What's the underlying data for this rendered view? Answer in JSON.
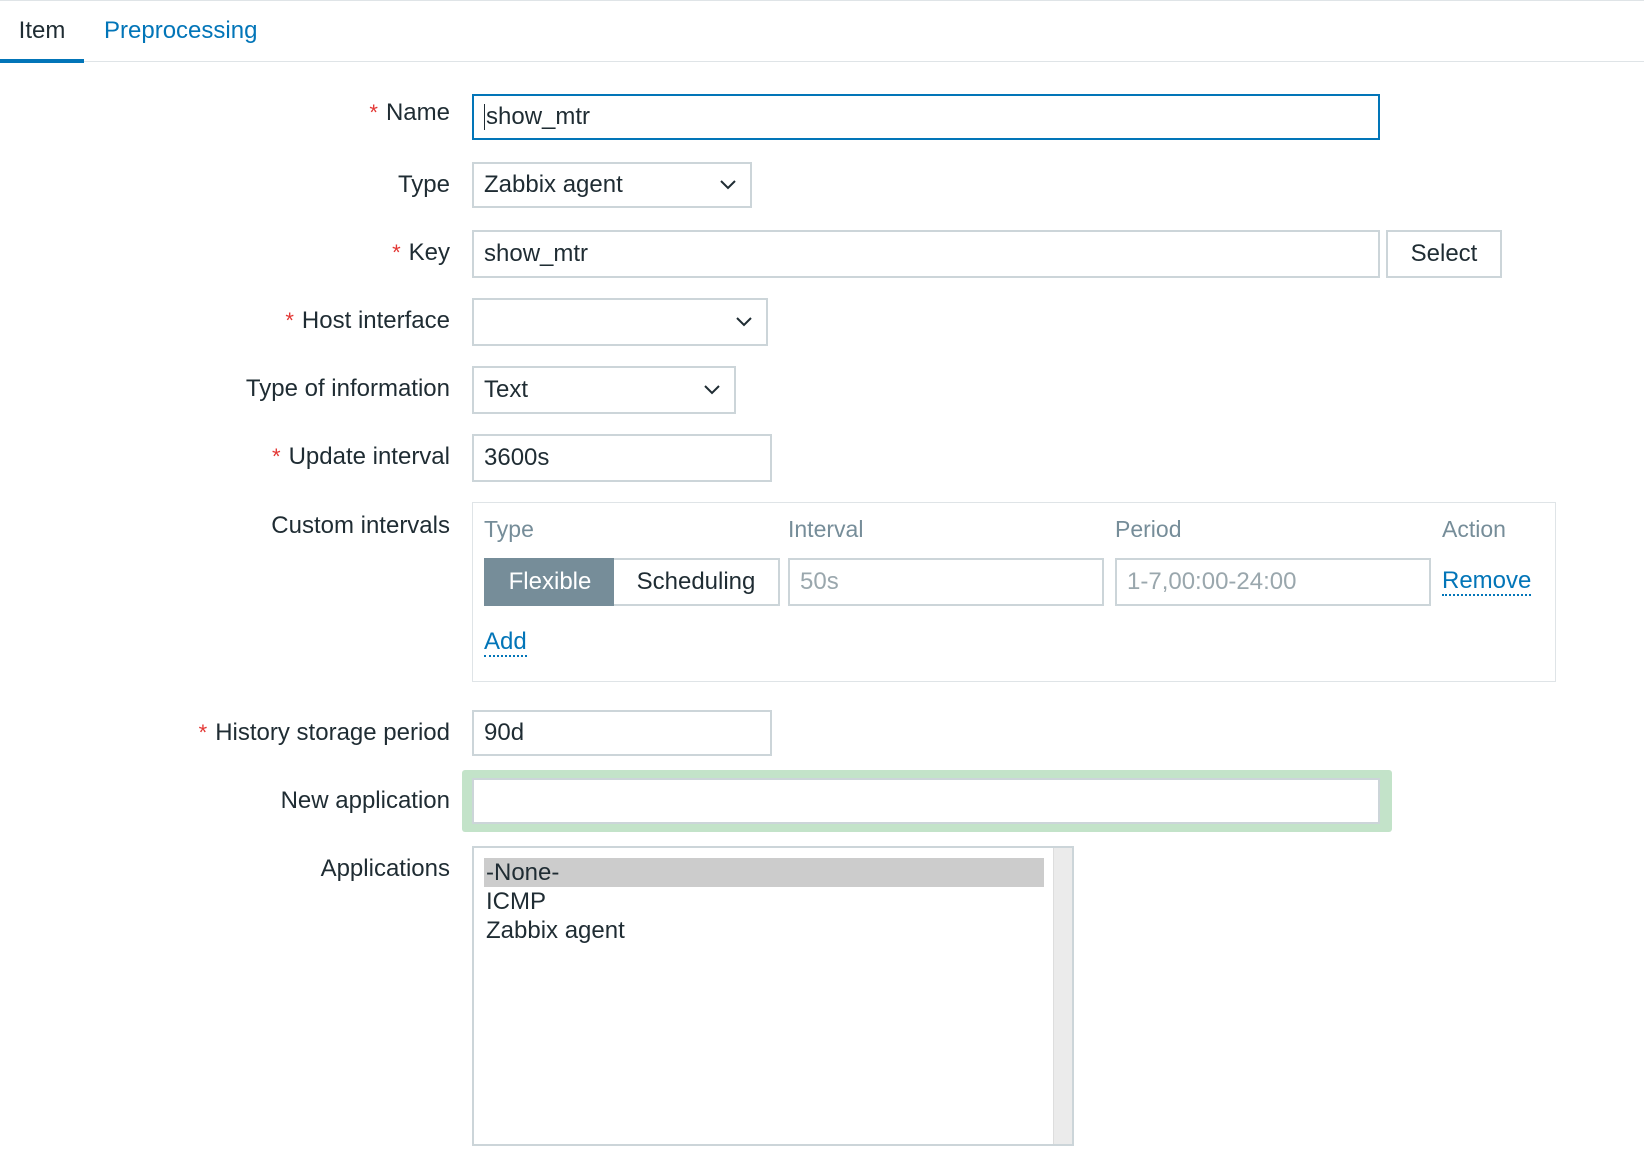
{
  "tabs": [
    {
      "label": "Item",
      "active": true
    },
    {
      "label": "Preprocessing",
      "active": false
    }
  ],
  "form": {
    "name": {
      "label": "Name",
      "value": "show_mtr",
      "required": true
    },
    "type": {
      "label": "Type",
      "value": "Zabbix agent"
    },
    "key": {
      "label": "Key",
      "value": "show_mtr",
      "required": true,
      "button": "Select"
    },
    "host_interface": {
      "label": "Host interface",
      "value": "",
      "required": true
    },
    "type_of_information": {
      "label": "Type of information",
      "value": "Text"
    },
    "update_interval": {
      "label": "Update interval",
      "value": "3600s",
      "required": true
    },
    "custom_intervals": {
      "label": "Custom intervals",
      "headers": [
        "Type",
        "Interval",
        "Period",
        "Action"
      ],
      "row": {
        "type_options": [
          "Flexible",
          "Scheduling"
        ],
        "type_selected": "Flexible",
        "interval_placeholder": "50s",
        "period_placeholder": "1-7,00:00-24:00",
        "remove_label": "Remove"
      },
      "add_label": "Add"
    },
    "history_storage_period": {
      "label": "History storage period",
      "value": "90d",
      "required": true
    },
    "new_application": {
      "label": "New application",
      "value": ""
    },
    "applications": {
      "label": "Applications",
      "options": [
        "-None-",
        "ICMP",
        "Zabbix agent"
      ],
      "selected": "-None-"
    }
  },
  "colors": {
    "accent": "#0275b8",
    "required": "#e33734",
    "segment_active": "#768d99",
    "highlight": "#c3e3c9"
  },
  "required_marker": "*"
}
